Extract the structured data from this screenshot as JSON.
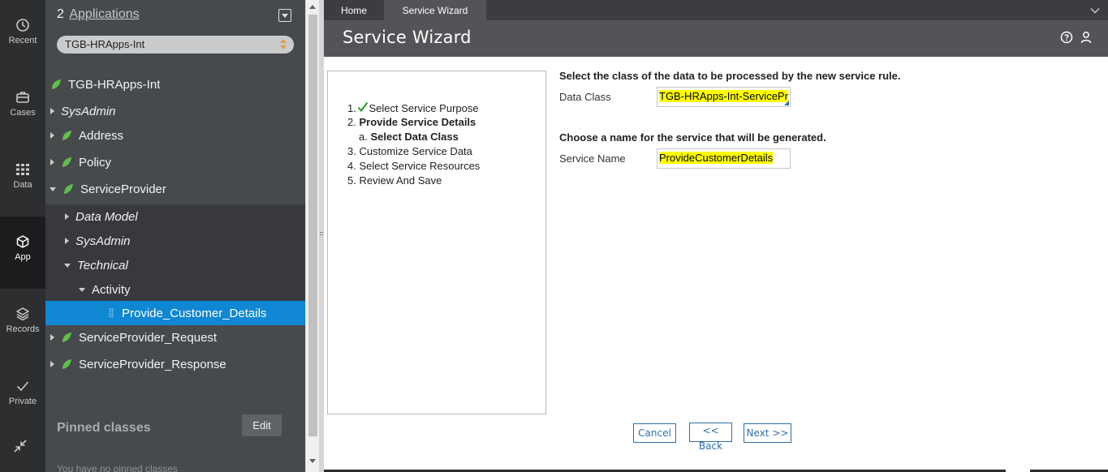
{
  "nav": {
    "items": [
      {
        "label": "Recent",
        "icon": "clock-icon"
      },
      {
        "label": "Cases",
        "icon": "briefcase-icon"
      },
      {
        "label": "Data",
        "icon": "grid-icon"
      },
      {
        "label": "App",
        "icon": "cube-icon"
      },
      {
        "label": "Records",
        "icon": "layers-icon"
      },
      {
        "label": "Private",
        "icon": "check-icon"
      }
    ],
    "collapse_icon": "collapse-arrows-icon"
  },
  "explorer": {
    "count": "2",
    "title": "Applications",
    "app_select": "TGB-HRApps-Int",
    "tree": {
      "root": "TGB-HRApps-Int",
      "sysadmin": "SysAdmin",
      "address": "Address",
      "policy": "Policy",
      "serviceprovider": "ServiceProvider",
      "data_model": "Data Model",
      "sysadmin_child": "SysAdmin",
      "technical": "Technical",
      "activity": "Activity",
      "selected_item": "Provide_Customer_Details",
      "request": "ServiceProvider_Request",
      "response": "ServiceProvider_Response"
    },
    "pinned_title": "Pinned classes",
    "edit_label": "Edit",
    "empty_text": "You have no pinned classes"
  },
  "tabs": [
    {
      "label": "Home"
    },
    {
      "label": "Service Wizard"
    }
  ],
  "header": {
    "title": "Service Wizard",
    "help_icon": "help-circle-icon",
    "user_icon": "user-icon"
  },
  "steps": {
    "s1_num": "1.",
    "s1_label": "Select Service Purpose",
    "s2": "2.",
    "s2_label": "Provide Service Details",
    "s2a_num": "a.",
    "s2a_label": "Select Data Class",
    "s3": "3. Customize Service Data",
    "s4": "4. Select Service Resources",
    "s5": "5. Review And Save"
  },
  "form": {
    "q1": "Select the class of the data to be processed by the new service rule.",
    "data_class_label": "Data Class",
    "data_class_value": "TGB-HRApps-Int-ServicePr",
    "q2": "Choose a name for the service that will be generated.",
    "service_name_label": "Service Name",
    "service_name_value": "ProvideCustomerDetails"
  },
  "buttons": {
    "cancel": "Cancel",
    "back": "<< Back",
    "next": "Next >>"
  },
  "colors": {
    "accent": "#0f87d2",
    "highlight": "#ffff00",
    "leaf": "#5fbf4a",
    "checkmark": "#2a9d2a",
    "button": "#2e6faa"
  }
}
